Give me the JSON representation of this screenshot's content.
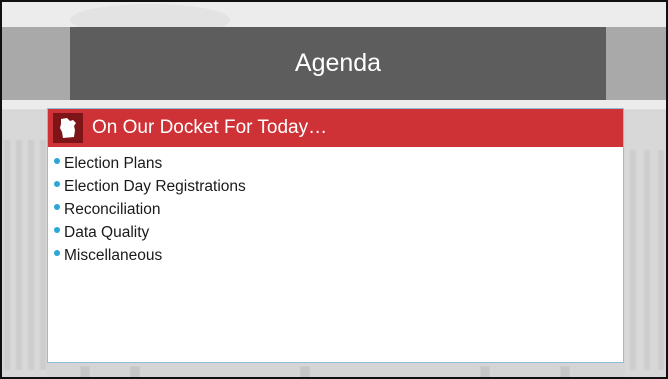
{
  "slide": {
    "title": "Agenda",
    "section": {
      "icon": "wisconsin-state-icon",
      "heading": "On Our Docket For Today…"
    },
    "items": [
      {
        "label": "Election Plans"
      },
      {
        "label": "Election Day Registrations"
      },
      {
        "label": "Reconciliation"
      },
      {
        "label": "Data Quality"
      },
      {
        "label": "Miscellaneous"
      }
    ]
  },
  "colors": {
    "title_box": "#5d5d5d",
    "title_band": "#a9a9a9",
    "header_bar": "#cf3236",
    "icon_box": "#7d1518",
    "bullet": "#2aa6d9",
    "content_border": "#8fbfd6"
  }
}
